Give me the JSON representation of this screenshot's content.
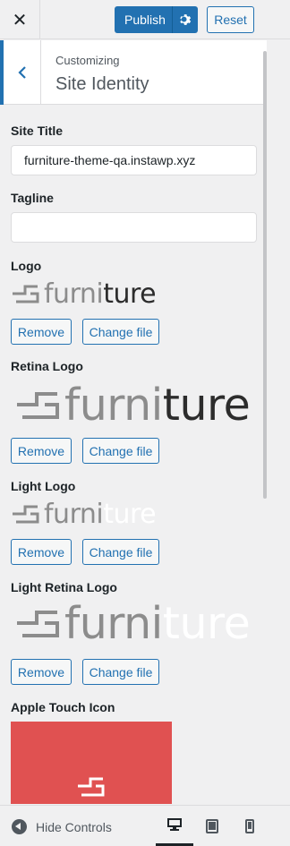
{
  "header": {
    "close_label": "✕",
    "publish_label": "Publish",
    "reset_label": "Reset"
  },
  "section": {
    "breadcrumb": "Customizing",
    "title": "Site Identity"
  },
  "fields": {
    "site_title": {
      "label": "Site Title",
      "value": "furniture-theme-qa.instawp.xyz"
    },
    "tagline": {
      "label": "Tagline",
      "value": ""
    }
  },
  "logos": [
    {
      "label": "Logo",
      "word_part1": "furni",
      "word_part2": "ture",
      "remove_label": "Remove",
      "change_label": "Change file"
    },
    {
      "label": "Retina Logo",
      "word_part1": "furni",
      "word_part2": "ture",
      "remove_label": "Remove",
      "change_label": "Change file"
    },
    {
      "label": "Light Logo",
      "word_part1": "furni",
      "word_part2": "ture",
      "remove_label": "Remove",
      "change_label": "Change file"
    },
    {
      "label": "Light Retina Logo",
      "word_part1": "furni",
      "word_part2": "ture",
      "remove_label": "Remove",
      "change_label": "Change file"
    }
  ],
  "apple_touch": {
    "label": "Apple Touch Icon",
    "bg_color": "#e05151"
  },
  "footer": {
    "hide_controls_label": "Hide Controls"
  },
  "colors": {
    "accent": "#2271b1",
    "background": "#f0f0f1"
  }
}
